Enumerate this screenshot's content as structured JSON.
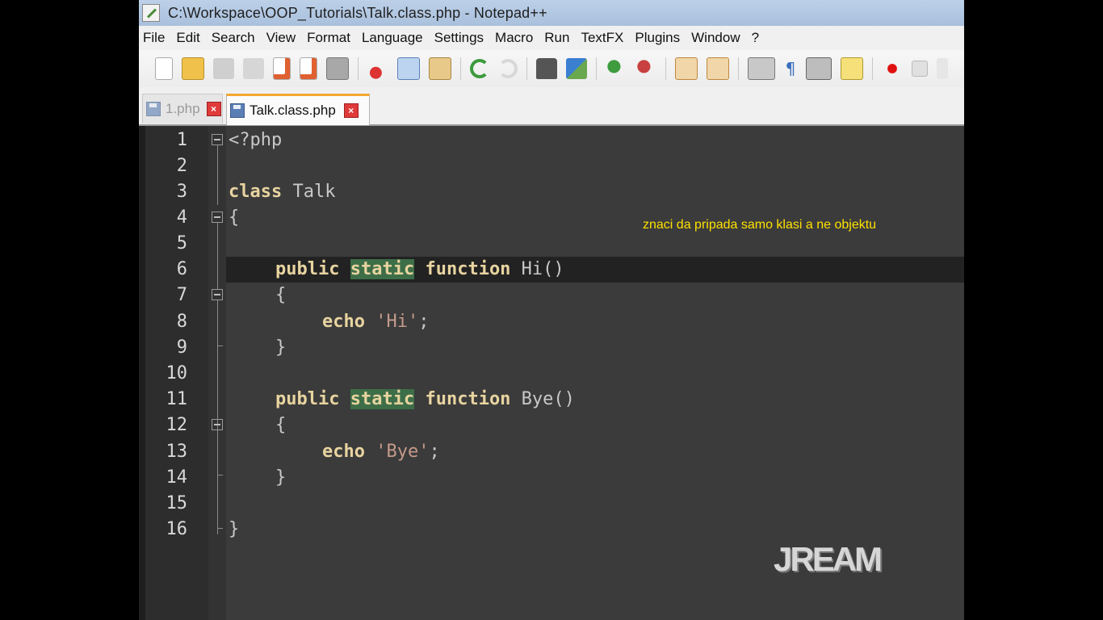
{
  "window": {
    "title": "C:\\Workspace\\OOP_Tutorials\\Talk.class.php - Notepad++"
  },
  "menu": [
    "File",
    "Edit",
    "Search",
    "View",
    "Format",
    "Language",
    "Settings",
    "Macro",
    "Run",
    "TextFX",
    "Plugins",
    "Window",
    "?"
  ],
  "toolbar": {
    "icons": [
      "new-file-icon",
      "open-file-icon",
      "save-icon",
      "save-all-icon",
      "close-icon",
      "close-all-icon",
      "print-icon",
      "cut-icon",
      "copy-icon",
      "paste-icon",
      "undo-icon",
      "redo-icon",
      "find-icon",
      "replace-icon",
      "zoom-in-icon",
      "zoom-out-icon",
      "sync-vertical-icon",
      "sync-horizontal-icon",
      "word-wrap-icon",
      "show-all-chars-icon",
      "indent-guide-icon",
      "user-lang-icon",
      "record-macro-icon",
      "stop-record-icon",
      "play-macro-icon"
    ]
  },
  "tabs": [
    {
      "label": "1.php",
      "active": false
    },
    {
      "label": "Talk.class.php",
      "active": true
    }
  ],
  "editor": {
    "line_numbers": [
      "1",
      "2",
      "3",
      "4",
      "5",
      "6",
      "7",
      "8",
      "9",
      "10",
      "11",
      "12",
      "13",
      "14",
      "15",
      "16"
    ],
    "current_line": 6,
    "tokens": {
      "php_open": "<?php",
      "kw_class": "class",
      "class_name": " Talk",
      "brace_open": "{",
      "brace_close": "}",
      "kw_public": "public",
      "kw_static": "static",
      "kw_function": "function",
      "fn_hi": " Hi()",
      "fn_bye": " Bye()",
      "kw_echo": "echo",
      "str_hi": "'Hi'",
      "str_bye": "'Bye'",
      "semicolon": ";"
    }
  },
  "annotation": "znaci da pripada samo klasi a ne objektu",
  "watermark": "JREAM",
  "colors": {
    "editor_bg": "#3b3b3b",
    "keyword": "#e8d4a0",
    "string": "#c49a8a",
    "highlight": "#3d6e48",
    "annotation": "#ffe100"
  }
}
